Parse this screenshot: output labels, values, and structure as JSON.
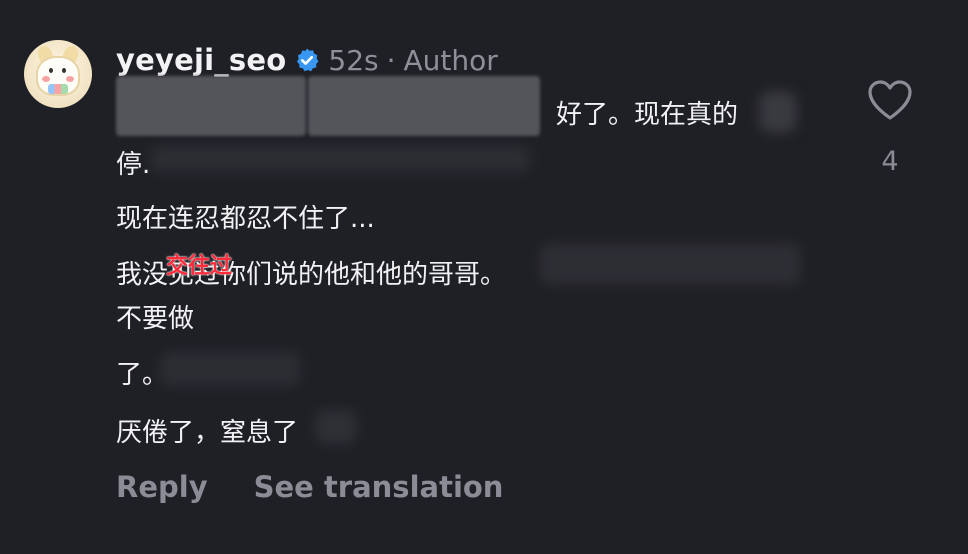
{
  "comment": {
    "username": "yeyeji_seo",
    "time": "52s",
    "separator": "·",
    "author_label": "Author",
    "lines": [
      "好了。现在真的",
      "停.",
      "现在连忍都忍不住了...",
      "我没见过你们说的他和他的哥哥。",
      "不要做",
      "了。",
      "厌倦了，窒息了"
    ],
    "overlay_text": "交往过",
    "reply_label": "Reply",
    "translation_label": "See translation",
    "like_count": "4"
  },
  "icons": {
    "avatar": "avatar-image",
    "verified": "verified-badge-icon",
    "like": "heart-icon"
  },
  "colors": {
    "background": "#1f2026",
    "text": "#f2f2f4",
    "muted": "#8a8c96",
    "verified_blue": "#3897f0",
    "overlay_red": "#ff2a3a"
  }
}
